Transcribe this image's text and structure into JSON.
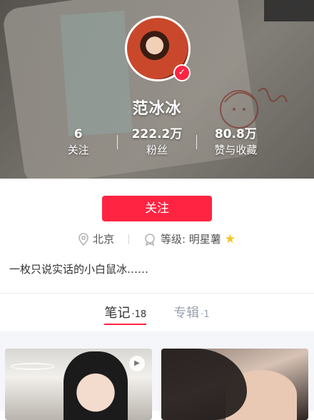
{
  "profile": {
    "name": "范冰冰",
    "verified_icon": "check-icon",
    "stats": [
      {
        "value": "6",
        "label": "关注"
      },
      {
        "value": "222.2万",
        "label": "粉丝"
      },
      {
        "value": "80.8万",
        "label": "赞与收藏"
      }
    ]
  },
  "actions": {
    "follow_label": "关注"
  },
  "meta": {
    "location_icon": "location-pin-icon",
    "location": "北京",
    "level_icon": "badge-icon",
    "level": "等级: 明星薯",
    "level_star": "★"
  },
  "bio": "一枚只说实话的小白鼠冰……",
  "tabs": [
    {
      "label": "笔记",
      "count": "·18",
      "active": true
    },
    {
      "label": "专辑",
      "count": "·1",
      "active": false
    }
  ],
  "feed": {
    "play_icon": "play-icon"
  },
  "colors": {
    "accent": "#ff2442",
    "star": "#f5c518"
  }
}
